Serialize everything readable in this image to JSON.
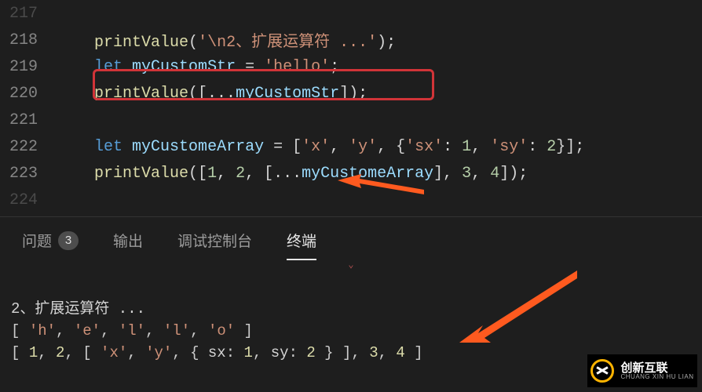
{
  "code_lines": [
    {
      "num": "217",
      "dim": true,
      "spans": []
    },
    {
      "num": "218",
      "dim": false,
      "spans": [
        {
          "t": "    ",
          "c": "pnc"
        },
        {
          "t": "printValue",
          "c": "fn"
        },
        {
          "t": "(",
          "c": "pnc"
        },
        {
          "t": "'\\n2、扩展运算符 ...'",
          "c": "str"
        },
        {
          "t": ");",
          "c": "pnc"
        }
      ]
    },
    {
      "num": "219",
      "dim": false,
      "spans": [
        {
          "t": "    ",
          "c": "pnc"
        },
        {
          "t": "let",
          "c": "kw"
        },
        {
          "t": " ",
          "c": "pnc"
        },
        {
          "t": "myCustomStr",
          "c": "var"
        },
        {
          "t": " = ",
          "c": "pnc"
        },
        {
          "t": "'hello'",
          "c": "str"
        },
        {
          "t": ";",
          "c": "pnc"
        }
      ]
    },
    {
      "num": "220",
      "dim": false,
      "spans": [
        {
          "t": "    ",
          "c": "pnc"
        },
        {
          "t": "printValue",
          "c": "fn"
        },
        {
          "t": "([...",
          "c": "pnc"
        },
        {
          "t": "myCustomStr",
          "c": "var"
        },
        {
          "t": "]);",
          "c": "pnc"
        }
      ]
    },
    {
      "num": "221",
      "dim": false,
      "spans": []
    },
    {
      "num": "222",
      "dim": false,
      "spans": [
        {
          "t": "    ",
          "c": "pnc"
        },
        {
          "t": "let",
          "c": "kw"
        },
        {
          "t": " ",
          "c": "pnc"
        },
        {
          "t": "myCustomeArray",
          "c": "var"
        },
        {
          "t": " = [",
          "c": "pnc"
        },
        {
          "t": "'x'",
          "c": "str"
        },
        {
          "t": ", ",
          "c": "pnc"
        },
        {
          "t": "'y'",
          "c": "str"
        },
        {
          "t": ", {",
          "c": "pnc"
        },
        {
          "t": "'sx'",
          "c": "str"
        },
        {
          "t": ": ",
          "c": "pnc"
        },
        {
          "t": "1",
          "c": "num"
        },
        {
          "t": ", ",
          "c": "pnc"
        },
        {
          "t": "'sy'",
          "c": "str"
        },
        {
          "t": ": ",
          "c": "pnc"
        },
        {
          "t": "2",
          "c": "num"
        },
        {
          "t": "}];",
          "c": "pnc"
        }
      ]
    },
    {
      "num": "223",
      "dim": false,
      "spans": [
        {
          "t": "    ",
          "c": "pnc"
        },
        {
          "t": "printValue",
          "c": "fn"
        },
        {
          "t": "([",
          "c": "pnc"
        },
        {
          "t": "1",
          "c": "num"
        },
        {
          "t": ", ",
          "c": "pnc"
        },
        {
          "t": "2",
          "c": "num"
        },
        {
          "t": ", [...",
          "c": "pnc"
        },
        {
          "t": "myCustomeArray",
          "c": "var"
        },
        {
          "t": "], ",
          "c": "pnc"
        },
        {
          "t": "3",
          "c": "num"
        },
        {
          "t": ", ",
          "c": "pnc"
        },
        {
          "t": "4",
          "c": "num"
        },
        {
          "t": "]);",
          "c": "pnc"
        }
      ]
    },
    {
      "num": "224",
      "dim": true,
      "spans": []
    }
  ],
  "tabs": {
    "problems": {
      "label": "问题",
      "badge": "3"
    },
    "output": {
      "label": "输出"
    },
    "debug": {
      "label": "调试控制台"
    },
    "terminal": {
      "label": "终端"
    }
  },
  "terminal_lines": [
    [
      {
        "t": "2、扩展运算符 ...",
        "c": "t-def"
      }
    ],
    [
      {
        "t": "[ ",
        "c": "t-br"
      },
      {
        "t": "'h'",
        "c": "t-str"
      },
      {
        "t": ", ",
        "c": "t-br"
      },
      {
        "t": "'e'",
        "c": "t-str"
      },
      {
        "t": ", ",
        "c": "t-br"
      },
      {
        "t": "'l'",
        "c": "t-str"
      },
      {
        "t": ", ",
        "c": "t-br"
      },
      {
        "t": "'l'",
        "c": "t-str"
      },
      {
        "t": ", ",
        "c": "t-br"
      },
      {
        "t": "'o'",
        "c": "t-str"
      },
      {
        "t": " ]",
        "c": "t-br"
      }
    ],
    [
      {
        "t": "[ ",
        "c": "t-br"
      },
      {
        "t": "1",
        "c": "t-num"
      },
      {
        "t": ", ",
        "c": "t-br"
      },
      {
        "t": "2",
        "c": "t-num"
      },
      {
        "t": ", [ ",
        "c": "t-br"
      },
      {
        "t": "'x'",
        "c": "t-str"
      },
      {
        "t": ", ",
        "c": "t-br"
      },
      {
        "t": "'y'",
        "c": "t-str"
      },
      {
        "t": ", { ",
        "c": "t-br"
      },
      {
        "t": "sx",
        "c": "t-def"
      },
      {
        "t": ": ",
        "c": "t-br"
      },
      {
        "t": "1",
        "c": "t-num"
      },
      {
        "t": ", ",
        "c": "t-br"
      },
      {
        "t": "sy",
        "c": "t-def"
      },
      {
        "t": ": ",
        "c": "t-br"
      },
      {
        "t": "2",
        "c": "t-num"
      },
      {
        "t": " } ], ",
        "c": "t-br"
      },
      {
        "t": "3",
        "c": "t-num"
      },
      {
        "t": ", ",
        "c": "t-br"
      },
      {
        "t": "4",
        "c": "t-num"
      },
      {
        "t": " ]",
        "c": "t-br"
      }
    ]
  ],
  "watermark": {
    "cn": "创新互联",
    "py": "CHUANG XIN HU LIAN"
  }
}
